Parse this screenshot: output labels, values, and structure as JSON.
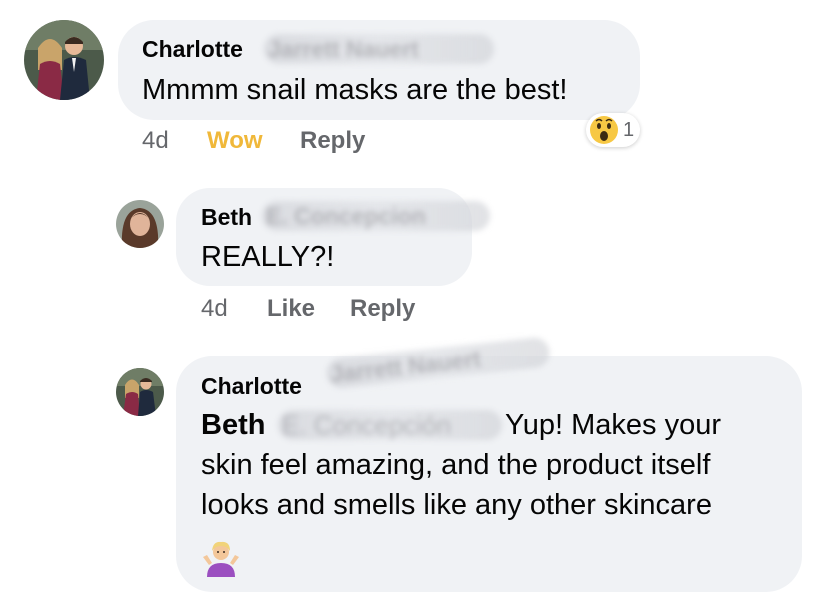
{
  "comments": [
    {
      "author_first": "Charlotte",
      "author_blurred": "Jarrett Nauert",
      "text": "Mmmm snail masks are the best!",
      "time": "4d",
      "reaction_label": "Wow",
      "reply_label": "Reply",
      "reaction_count": "1",
      "reaction_icon": "wow-face-icon"
    },
    {
      "author_first": "Beth",
      "author_blurred": "E. Concepcion",
      "text": "REALLY?!",
      "time": "4d",
      "like_label": "Like",
      "reply_label": "Reply"
    },
    {
      "author_first": "Charlotte",
      "author_blurred": "Jarrett Nauert",
      "mention_first": "Beth",
      "mention_blurred": "E. Concepción",
      "text_line1": "Yup! Makes your",
      "text_line2": "skin feel amazing, and the product itself",
      "text_line3": "looks and smells like any other skincare",
      "emoji_icon": "person-shrugging-icon"
    }
  ],
  "colors": {
    "bubble": "#f0f2f5",
    "secondary_text": "#65676b",
    "wow": "#f0b83a"
  }
}
